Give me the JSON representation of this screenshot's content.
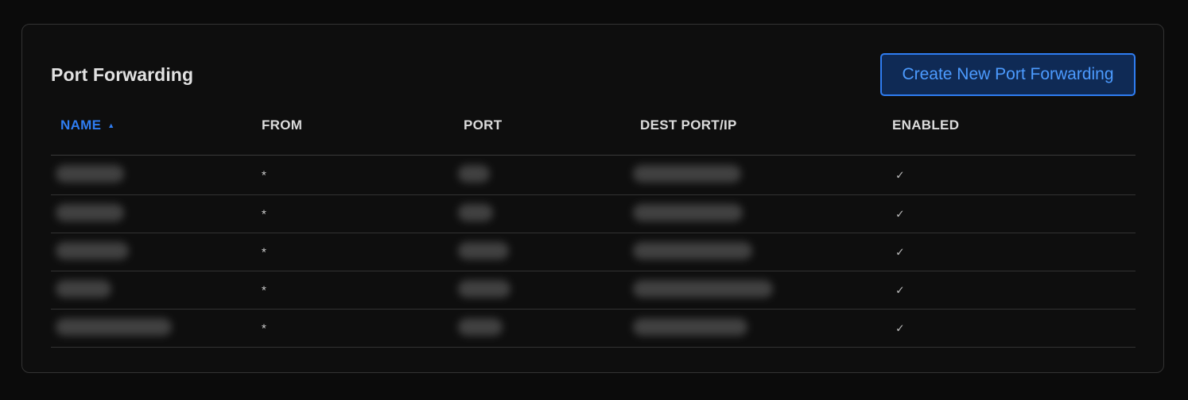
{
  "title": "Port Forwarding",
  "create_button_label": "Create New Port Forwarding",
  "columns": [
    {
      "label": "NAME",
      "sorted": true,
      "sort_icon": "sort-ascending-icon"
    },
    {
      "label": "FROM"
    },
    {
      "label": "PORT"
    },
    {
      "label": "DEST PORT/IP"
    },
    {
      "label": "ENABLED"
    }
  ],
  "rows": [
    {
      "name": "[redacted]",
      "from": "*",
      "port": "[redacted]",
      "dest": "[redacted]",
      "enabled": "✓"
    },
    {
      "name": "[redacted]",
      "from": "*",
      "port": "[redacted]",
      "dest": "[redacted]",
      "enabled": "✓"
    },
    {
      "name": "[redacted]",
      "from": "*",
      "port": "[redacted]",
      "dest": "[redacted]",
      "enabled": "✓"
    },
    {
      "name": "[redacted]",
      "from": "*",
      "port": "[redacted]",
      "dest": "[redacted]",
      "enabled": "✓"
    },
    {
      "name": "[redacted]",
      "from": "*",
      "port": "[redacted]",
      "dest": "[redacted]",
      "enabled": "✓"
    }
  ],
  "colors": {
    "accent": "#2f7df2",
    "background": "#0b0b0b",
    "card_border": "#333333",
    "text": "#e2e2e2"
  }
}
